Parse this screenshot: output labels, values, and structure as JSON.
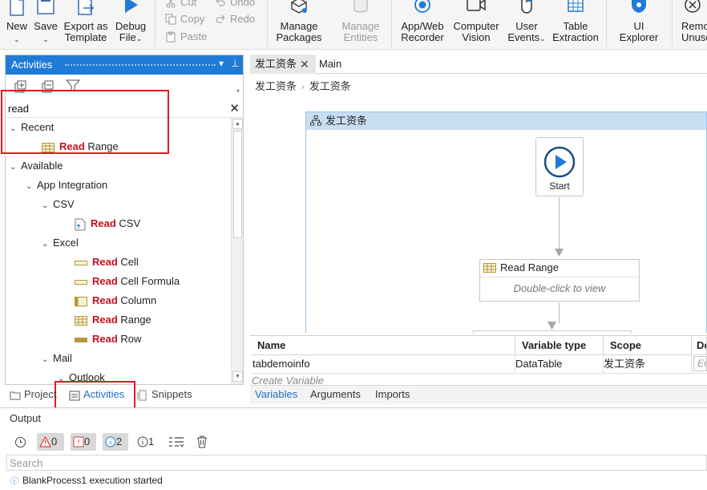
{
  "ribbon": {
    "new": "New",
    "save": "Save",
    "export_line1": "Export as",
    "export_line2": "Template",
    "debug_line1": "Debug",
    "debug_line2": "File",
    "cut": "Cut",
    "copy": "Copy",
    "paste": "Paste",
    "undo": "Undo",
    "redo": "Redo",
    "manage_packages_1": "Manage",
    "manage_packages_2": "Packages",
    "manage_entities_1": "Manage",
    "manage_entities_2": "Entities",
    "recorder_1": "App/Web",
    "recorder_2": "Recorder",
    "vision_1": "Computer",
    "vision_2": "Vision",
    "user_events_1": "User",
    "user_events_2": "Events",
    "table_1": "Table",
    "table_2": "Extraction",
    "ui_explorer_1": "UI",
    "ui_explorer_2": "Explorer",
    "remove_1": "Remo",
    "remove_2": "Unuse"
  },
  "activities": {
    "title": "Activities",
    "search_value": "read",
    "recent": "Recent",
    "available": "Available",
    "app_integration": "App Integration",
    "csv": "CSV",
    "excel": "Excel",
    "mail": "Mail",
    "outlook": "Outlook",
    "match": "Read",
    "recent_item_rest": "Range",
    "csv_item_rest": "CSV",
    "excel_items": [
      "Cell",
      "Cell Formula",
      "Column",
      "Range",
      "Row"
    ]
  },
  "left_tabs": {
    "project": "Project",
    "activities": "Activities",
    "snippets": "Snippets"
  },
  "designer": {
    "tab_active": "发工资条",
    "tab_main": "Main",
    "breadcrumb_1": "发工资条",
    "breadcrumb_2": "发工资条",
    "sequence_title": "发工资条",
    "start_label": "Start",
    "activity_title": "Read Range",
    "activity_hint": "Double-click to view"
  },
  "variables": {
    "headers": [
      "Name",
      "Variable type",
      "Scope",
      "De"
    ],
    "row": [
      "tabdemoinfo",
      "DataTable",
      "发工资条",
      "En"
    ],
    "create": "Create Variable",
    "tabs": [
      "Variables",
      "Arguments",
      "Imports"
    ]
  },
  "output": {
    "title": "Output",
    "errors": "0",
    "warnings": "0",
    "info": "2",
    "trace": "1",
    "search_placeholder": "Search",
    "log": "BlankProcess1 execution started"
  },
  "colors": {
    "accent": "#1f7bd6",
    "highlight": "#c1121f",
    "annotation": "#e11b1b"
  }
}
